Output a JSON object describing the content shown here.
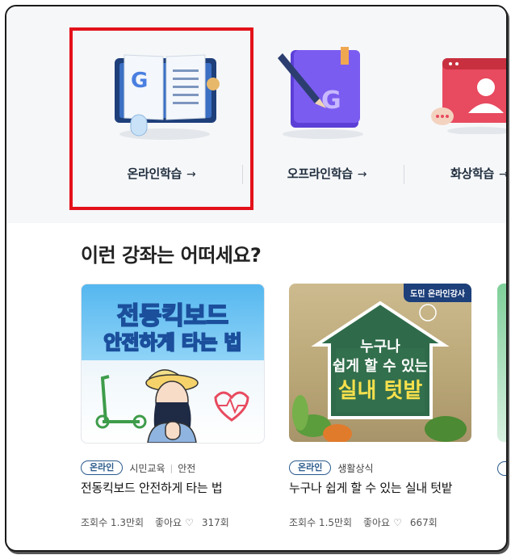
{
  "categories": [
    {
      "label": "온라인학습",
      "arrow": "→"
    },
    {
      "label": "오프라인학습",
      "arrow": "→"
    },
    {
      "label": "화상학습",
      "arrow": "→"
    }
  ],
  "section": {
    "title": "이런 강좌는 어떠세요?"
  },
  "courses": [
    {
      "thumb_line1": "전동킥보드",
      "thumb_line2": "안전하게 타는 법",
      "badge": "온라인",
      "category": "시민교육",
      "divider": "|",
      "subcategory": "안전",
      "title": "전동킥보드 안전하게 타는 법",
      "views": "조회수 1.3만회",
      "likes_label": "좋아요",
      "likes": "317회"
    },
    {
      "tag": "도민 온라인강사",
      "thumb_line1": "누구나",
      "thumb_line2": "쉽게 할 수 있는",
      "thumb_line3": "실내 텃밭",
      "badge": "온라인",
      "category": "생활상식",
      "title": "누구나 쉽게 할 수 있는 실내 텃밭",
      "views": "조회수 1.5만회",
      "likes_label": "좋아요",
      "likes": "667회"
    }
  ],
  "colors": {
    "highlight": "#e3111a",
    "badge": "#2a5a8c"
  }
}
